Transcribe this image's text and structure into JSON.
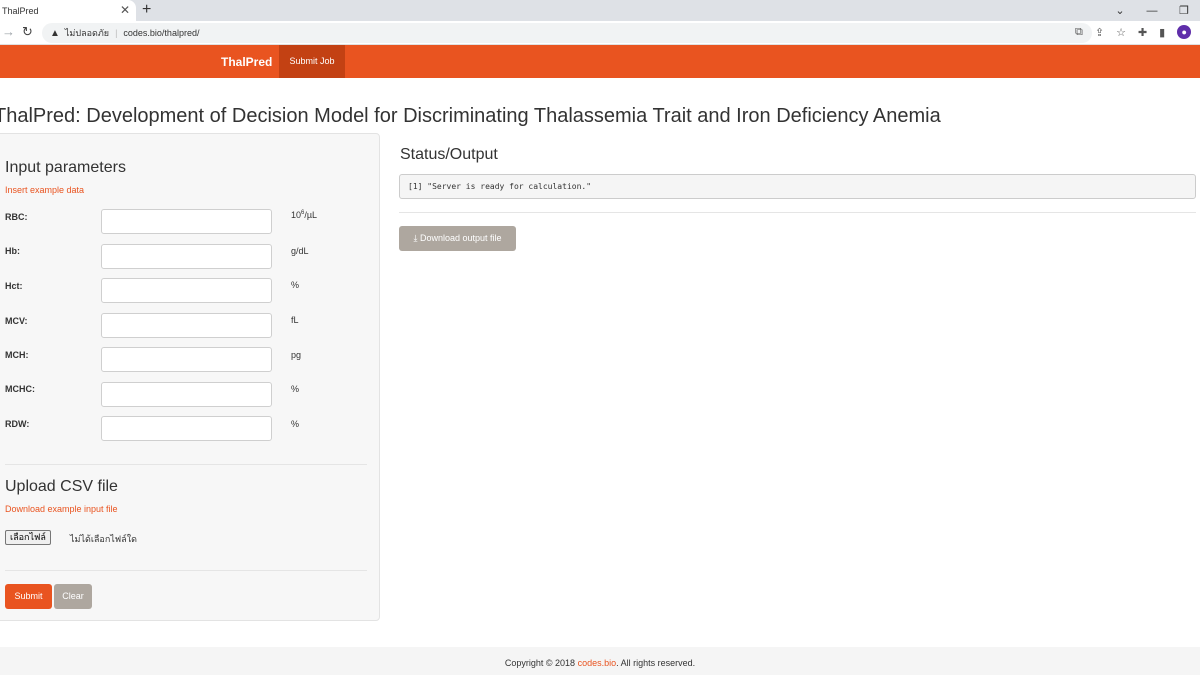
{
  "browser": {
    "tab_title": "ThalPred",
    "tab_close": "✕",
    "new_tab": "+",
    "security_label": "ไม่ปลอดภัย",
    "url": "codes.bio/thalpred/"
  },
  "navbar": {
    "brand": "ThalPred",
    "active_item": "Submit Job"
  },
  "page_title": "ThalPred: Development of Decision Model for Discriminating Thalassemia Trait and Iron Deficiency Anemia",
  "sidebar": {
    "input_title": "Input parameters",
    "example_link": "Insert example data",
    "fields": [
      {
        "label": "RBC:",
        "value": "",
        "unit_base": "10",
        "unit_sup": "6",
        "unit_tail": "/µL"
      },
      {
        "label": "Hb:",
        "value": "",
        "unit": "g/dL"
      },
      {
        "label": "Hct:",
        "value": "",
        "unit": "%"
      },
      {
        "label": "MCV:",
        "value": "",
        "unit": "fL"
      },
      {
        "label": "MCH:",
        "value": "",
        "unit": "pg"
      },
      {
        "label": "MCHC:",
        "value": "",
        "unit": "%"
      },
      {
        "label": "RDW:",
        "value": "",
        "unit": "%"
      }
    ],
    "upload_title": "Upload CSV file",
    "download_example_link": "Download example input file",
    "file_button": "เลือกไฟล์",
    "file_status": "ไม่ได้เลือกไฟล์ใด",
    "submit_label": "Submit",
    "clear_label": "Clear"
  },
  "main": {
    "status_title": "Status/Output",
    "output_text": "[1] \"Server is ready for calculation.\"",
    "download_label": "Download output file"
  },
  "footer": {
    "prefix": "Copyright © 2018 ",
    "site": "codes.bio",
    "suffix": ". All rights reserved."
  },
  "colors": {
    "accent": "#e95420",
    "accent_dark": "#c34113",
    "muted_button": "#aea79f"
  }
}
